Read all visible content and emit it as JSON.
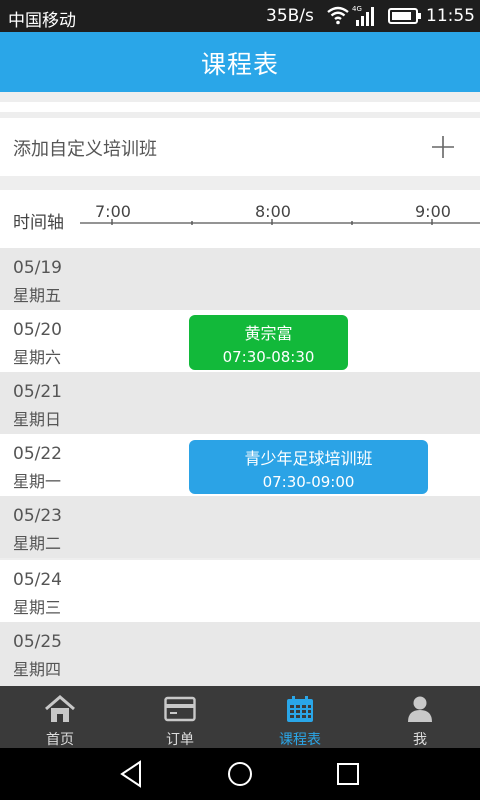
{
  "status_bar": {
    "carrier": "中国移动",
    "net_speed": "35B/s",
    "cell_label": "4G",
    "battery_level": 0.85,
    "time": "11:55"
  },
  "app_bar": {
    "title": "课程表"
  },
  "add_class": {
    "label": "添加自定义培训班",
    "icon": "plus-icon"
  },
  "timeline": {
    "label": "时间轴",
    "ticks": [
      "7:00",
      "8:00",
      "9:00"
    ]
  },
  "days": [
    {
      "date": "05/19",
      "weekday": "星期五"
    },
    {
      "date": "05/20",
      "weekday": "星期六"
    },
    {
      "date": "05/21",
      "weekday": "星期日"
    },
    {
      "date": "05/22",
      "weekday": "星期一"
    },
    {
      "date": "05/23",
      "weekday": "星期二"
    },
    {
      "date": "05/24",
      "weekday": "星期三"
    },
    {
      "date": "05/25",
      "weekday": "星期四"
    }
  ],
  "events": [
    {
      "name": "黄宗富",
      "time": "07:30-08:30",
      "day": "05/20",
      "start": "07:30",
      "end": "08:30",
      "color": "#12b93a"
    },
    {
      "name": "青少年足球培训班",
      "time": "07:30-09:00",
      "day": "05/22",
      "start": "07:30",
      "end": "09:00",
      "color": "#2ba3e6"
    }
  ],
  "tabs": [
    {
      "label": "首页",
      "icon": "home-icon",
      "active": false
    },
    {
      "label": "订单",
      "icon": "card-icon",
      "active": false
    },
    {
      "label": "课程表",
      "icon": "calendar-icon",
      "active": true
    },
    {
      "label": "我",
      "icon": "user-icon",
      "active": false
    }
  ],
  "colors": {
    "accent": "#2aa6e8",
    "tab_bar": "#3a3a3a"
  }
}
